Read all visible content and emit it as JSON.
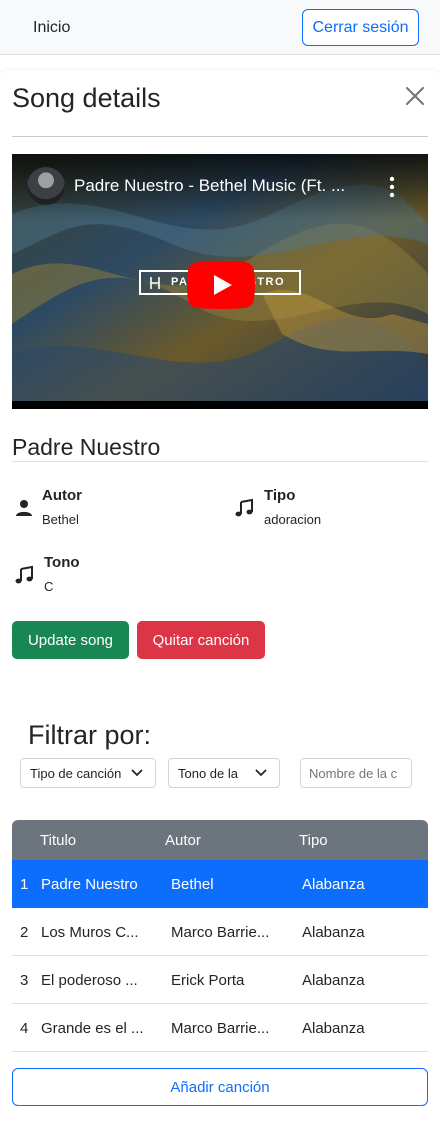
{
  "navbar": {
    "home_link": "Inicio",
    "logout_label": "Cerrar sesión"
  },
  "modal": {
    "title": "Song details",
    "video": {
      "title": "Padre Nuestro - Bethel Music (Ft. ...",
      "brand_text": "PADRE NUESTRO"
    },
    "song": {
      "title": "Padre Nuestro",
      "fields": [
        {
          "label": "Autor",
          "value": "Bethel",
          "icon": "person-icon"
        },
        {
          "label": "Tipo",
          "value": "adoracion",
          "icon": "music-note-icon"
        },
        {
          "label": "Tono",
          "value": "C",
          "icon": "music-note-icon"
        }
      ]
    },
    "update_label": "Update song",
    "remove_label": "Quitar canción"
  },
  "filters": {
    "title": "Filtrar por:",
    "type_select": "Tipo de canción",
    "key_select": "Tono de la",
    "name_placeholder": "Nombre de la c"
  },
  "table": {
    "headers": [
      "Titulo",
      "Autor",
      "Tipo"
    ],
    "rows": [
      {
        "num": "1",
        "title": "Padre Nuestro",
        "author": "Bethel",
        "type": "Alabanza",
        "active": true
      },
      {
        "num": "2",
        "title": "Los Muros C...",
        "author": "Marco Barrie...",
        "type": "Alabanza",
        "active": false
      },
      {
        "num": "3",
        "title": "El poderoso ...",
        "author": "Erick Porta",
        "type": "Alabanza",
        "active": false
      },
      {
        "num": "4",
        "title": "Grande es el ...",
        "author": "Marco Barrie...",
        "type": "Alabanza",
        "active": false
      }
    ]
  },
  "add_label": "Añadir canción",
  "colors": {
    "primary": "#0d6efd",
    "success": "#198754",
    "danger": "#dc3545",
    "table_header": "#6c757d"
  }
}
